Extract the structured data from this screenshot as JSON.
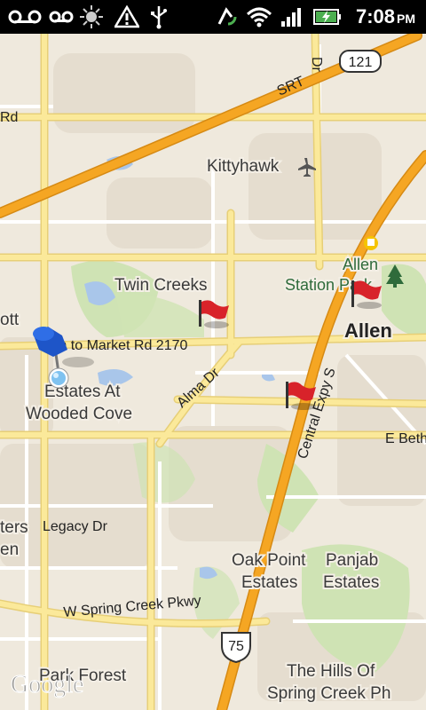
{
  "status_bar": {
    "time": "7:08",
    "ampm": "PM",
    "icons": [
      "voicemail-icon",
      "brightness-icon",
      "warning-icon",
      "usb-icon",
      "sync-icon",
      "wifi-icon",
      "signal-icon",
      "battery-charging-icon"
    ]
  },
  "colors": {
    "land": "#efe9dd",
    "highway": "#f5a623",
    "major_road": "#fbe99a",
    "minor_road": "#ffffff",
    "water": "#a9c6ea",
    "park": "#cfe3b4",
    "residential": "#e6dfd1"
  },
  "map": {
    "labels": {
      "srt": "SRT",
      "hw121": "121",
      "rd_left": "Rd",
      "dr_top": "Dr",
      "kittyhawk": "Kittyhawk",
      "allen_top": "Allen",
      "station_park": "Station Park",
      "allen_city": "Allen",
      "twin_creeks": "Twin Creeks",
      "ott": "ott",
      "fm2170": "m to Market Rd 2170",
      "estates_line1": "Estates At",
      "estates_line2": "Wooded Cove",
      "alma_dr": "Alma Dr",
      "central_expy": "Central Expy S",
      "e_beth": "E Beth",
      "legacy_dr": "Legacy Dr",
      "ters": "ters",
      "en": "en",
      "oak_point_line1": "Oak Point",
      "oak_point_line2": "Estates",
      "panjab_line1": "Panjab",
      "panjab_line2": "Estates",
      "w_spring_creek": "W Spring Creek Pkwy",
      "hw75": "75",
      "park_forest": "Park Forest",
      "hills_line1": "The Hills Of",
      "hills_line2": "Spring Creek Ph",
      "google_logo": "Google"
    },
    "markers": {
      "pin": "push-pin-icon",
      "flags": [
        "flag-twin-creeks",
        "flag-allen",
        "flag-central-expy"
      ]
    }
  }
}
